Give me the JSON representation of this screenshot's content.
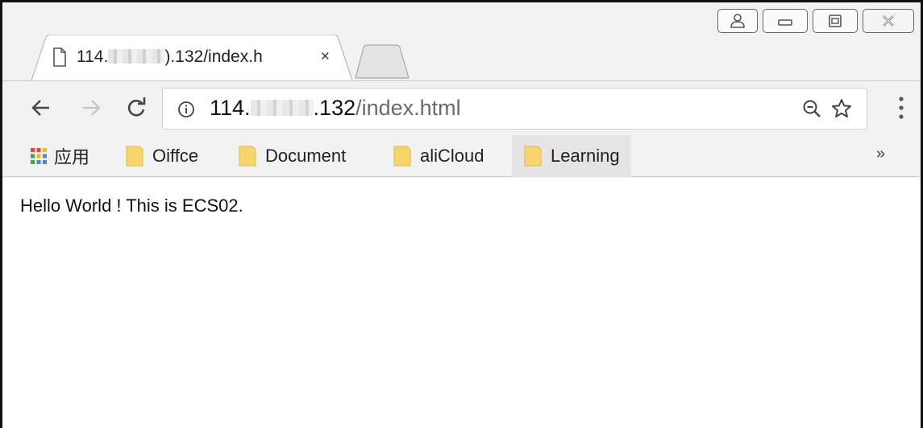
{
  "tab": {
    "title_prefix": "114.",
    "title_suffix": ").132/index.h",
    "close_glyph": "×"
  },
  "address_bar": {
    "host_prefix": "114.",
    "host_suffix": ".132",
    "path": "/index.html"
  },
  "bookmarks": {
    "apps_label": "应用",
    "items": [
      {
        "label": "Oiffce"
      },
      {
        "label": "Document"
      },
      {
        "label": "aliCloud"
      },
      {
        "label": "Learning"
      }
    ],
    "overflow": "»"
  },
  "page": {
    "body_text": "Hello World ! This is ECS02."
  },
  "icons": {
    "page": "page-icon",
    "back": "back-arrow-icon",
    "forward": "forward-arrow-icon",
    "reload": "reload-icon",
    "info": "info-icon",
    "zoom": "zoom-out-icon",
    "bookmark": "star-icon",
    "menu": "kebab-menu-icon",
    "folder": "folder-icon",
    "apps": "apps-grid-icon"
  },
  "colors": {
    "folder": "#f7d56b",
    "chrome_bg": "#f2f2f2",
    "apps_grid": [
      "#ea4335",
      "#fbbc05",
      "#34a853",
      "#4285f4"
    ]
  }
}
